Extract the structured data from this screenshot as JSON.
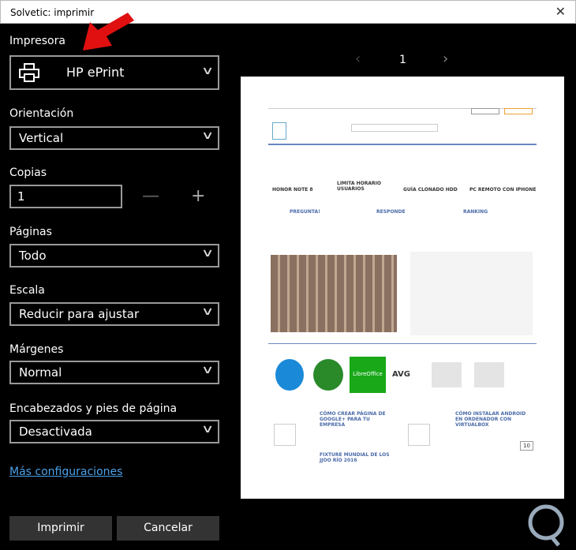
{
  "window": {
    "title": "Solvetic: imprimir"
  },
  "printer": {
    "label": "Impresora",
    "value": "HP ePrint"
  },
  "orientation": {
    "label": "Orientación",
    "value": "Vertical"
  },
  "copies": {
    "label": "Copias",
    "value": "1",
    "minus": "—",
    "plus": "+"
  },
  "pages": {
    "label": "Páginas",
    "value": "Todo"
  },
  "scale": {
    "label": "Escala",
    "value": "Reducir para ajustar"
  },
  "margins": {
    "label": "Márgenes",
    "value": "Normal"
  },
  "headers": {
    "label": "Encabezados y pies de página",
    "value": "Desactivada"
  },
  "more_settings": "Más configuraciones",
  "buttons": {
    "print": "Imprimir",
    "cancel": "Cancelar"
  },
  "preview": {
    "page_number": "1",
    "prev": "‹",
    "next": "›",
    "headlines": [
      "HONOR NOTE 8",
      "LIMITA HORARIO USUARIOS",
      "GUÍA CLONADO HDD",
      "PC REMOTO CON IPHONE"
    ],
    "cards": [
      "PREGUNTA!",
      "RESPONDE",
      "RANKING"
    ],
    "apps": [
      "LibreOffice",
      "AVG"
    ],
    "posts": [
      "CÓMO CREAR PÁGINA DE GOOGLE+ PARA TU EMPRESA",
      "FIXTURE MUNDIAL DE LOS JJOO RÍO 2016",
      "CÓMO INSTALAR ANDROID EN ORDENADOR CON VIRTUALBOX"
    ],
    "counter": "10"
  },
  "colors": {
    "accent_link": "#4aa0e8",
    "arrow": "#e01010"
  }
}
